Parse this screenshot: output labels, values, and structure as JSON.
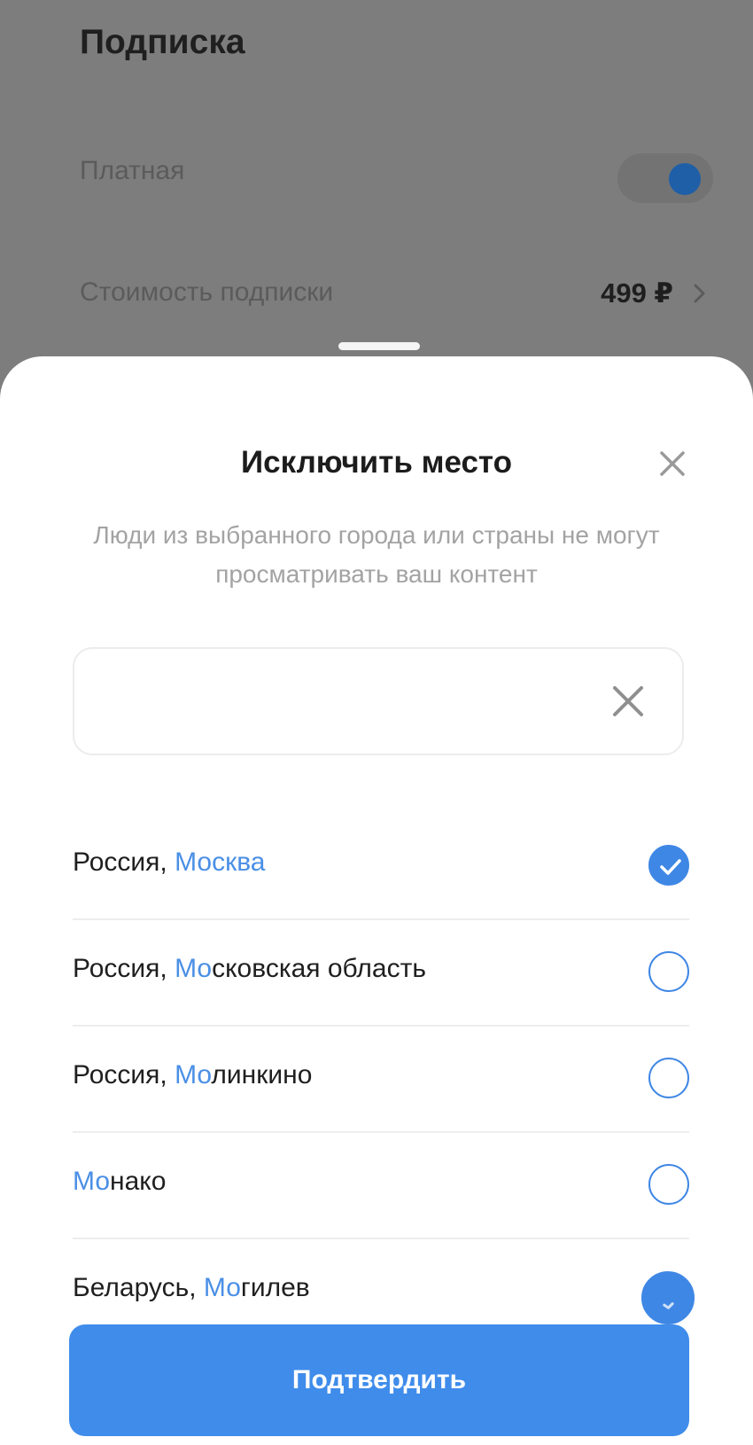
{
  "background": {
    "title": "Подписка",
    "paid_label": "Платная",
    "price_label": "Стоимость подписки",
    "price_value": "499 ₽"
  },
  "sheet": {
    "title": "Исключить место",
    "description": "Люди из выбранного города или страны не могут просматривать ваш контент",
    "search": {
      "value": "",
      "placeholder": ""
    },
    "items": [
      {
        "prefix": "Россия, ",
        "match": "Москва",
        "rest": "",
        "checked": true
      },
      {
        "prefix": "Россия, ",
        "match": "Мо",
        "rest": "сковская область",
        "checked": false
      },
      {
        "prefix": "Россия, ",
        "match": "Мо",
        "rest": "линкино",
        "checked": false
      },
      {
        "prefix": "",
        "match": "Мо",
        "rest": "нако",
        "checked": false
      },
      {
        "prefix": "Беларусь, ",
        "match": "Мо",
        "rest": "гилев",
        "checked": true
      }
    ],
    "confirm_label": "Подтвердить"
  },
  "colors": {
    "accent": "#3f8ceb",
    "highlight": "#4a8fe6",
    "dim_overlay": "#7d7d7d"
  },
  "icons": {
    "close": "close-icon",
    "clear": "clear-icon",
    "check": "checkmark-icon",
    "chevron": "chevron-right-icon"
  }
}
